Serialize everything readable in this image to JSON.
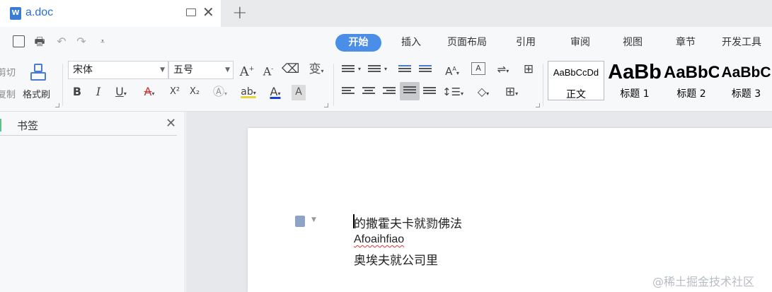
{
  "tab": {
    "title": "a.doc",
    "doc_icon": "W"
  },
  "menu": [
    "开始",
    "插入",
    "页面布局",
    "引用",
    "审阅",
    "视图",
    "章节",
    "开发工具"
  ],
  "ribbon": {
    "cut_label": "剪切",
    "copy_label": "复制",
    "format_painter_label": "格式刷",
    "font_name": "宋体",
    "font_size": "五号",
    "bold": "B",
    "italic": "I",
    "underline": "U",
    "strike": "A",
    "superscript": "X²",
    "subscript": "X₂",
    "font_color": "A",
    "char_shade": "A",
    "highlight": "ab"
  },
  "styles": [
    {
      "sample": "AaBbCcDd",
      "name": "正文"
    },
    {
      "sample": "AaBb",
      "name": "标题 1"
    },
    {
      "sample": "AaBbC",
      "name": "标题 2"
    },
    {
      "sample": "AaBbC",
      "name": "标题 3"
    }
  ],
  "panel": {
    "title": "书签"
  },
  "document": {
    "lines": [
      "的撒霍夫卡就勠佛法",
      "Afoaihfiao",
      "奥埃夫就公司里"
    ]
  },
  "watermark": "@稀土掘金技术社区",
  "colors": {
    "accent": "#4a8ee8",
    "tab_text": "#2b6fd6"
  }
}
